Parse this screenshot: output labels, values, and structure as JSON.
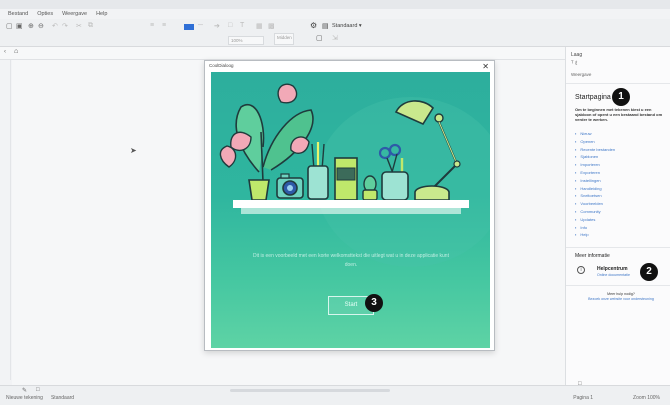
{
  "window": {
    "title": ""
  },
  "menu": [
    "Bestand",
    "Opties",
    "Weergave",
    "Help"
  ],
  "toolbar": {
    "zoom_field": "100%",
    "size_field": "Midden",
    "font_dropdown": "Standaard",
    "accent_color": "#2f6fd6"
  },
  "dialog": {
    "title": "CoolDialoog",
    "message": "Dit is een voorbeeld met een korte welkomsttekst die uitlegt wat u in deze applicatie kunt doen.",
    "button_label": "Start"
  },
  "panel": {
    "title": "Laag",
    "subtitle": "Weergave",
    "start_heading": "Startpagina",
    "start_description": "Om te beginnen met tekenen kiest u een sjabloon of opent u een bestaand bestand om verder te werken.",
    "links": [
      "Nieuw",
      "Openen",
      "Recente bestanden",
      "Sjablonen",
      "Importeren",
      "Exporteren",
      "Instellingen",
      "Handleiding",
      "Sneltoetsen",
      "Voorbeelden",
      "Community",
      "Updates",
      "Info",
      "Help"
    ],
    "more_heading": "Meer informatie",
    "help_label": "Helpcentrum",
    "help_sub": "Online documentatie",
    "box_line1": "Meer hulp nodig?",
    "box_line2": "Bezoek onze website voor ondersteuning"
  },
  "status": {
    "left": [
      "Nieuwe tekening",
      "Standaard"
    ],
    "right": [
      "Pagina 1",
      "Zoom 100%"
    ]
  },
  "callouts": [
    "1",
    "2",
    "3"
  ]
}
